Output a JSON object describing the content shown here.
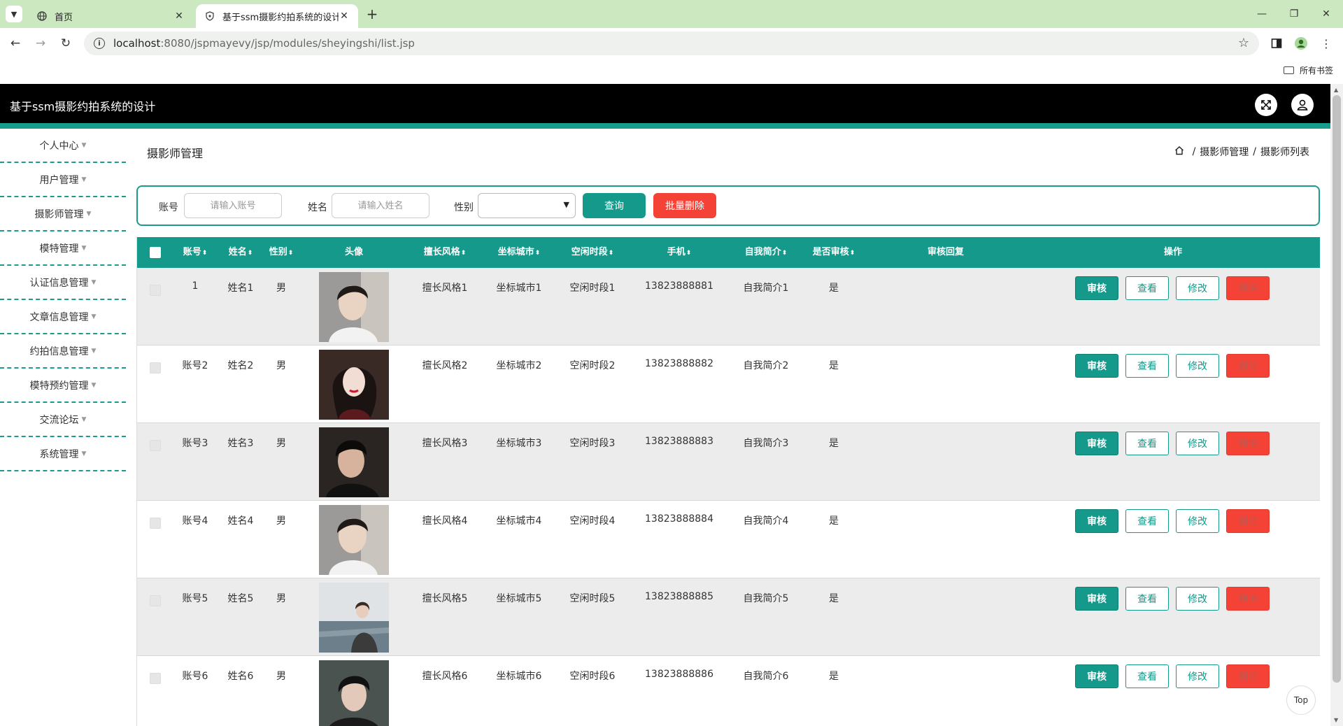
{
  "browser": {
    "tabs": [
      {
        "label": "首页",
        "active": false
      },
      {
        "label": "基于ssm摄影约拍系统的设计",
        "active": true
      }
    ],
    "url_host": "localhost",
    "url_rest": ":8080/jspmayevy/jsp/modules/sheyingshi/list.jsp",
    "bookmarks_label": "所有书签"
  },
  "header": {
    "title": "基于ssm摄影约拍系统的设计"
  },
  "sidebar": {
    "items": [
      {
        "label": "个人中心"
      },
      {
        "label": "用户管理"
      },
      {
        "label": "摄影师管理"
      },
      {
        "label": "模特管理"
      },
      {
        "label": "认证信息管理"
      },
      {
        "label": "文章信息管理"
      },
      {
        "label": "约拍信息管理"
      },
      {
        "label": "模特预约管理"
      },
      {
        "label": "交流论坛"
      },
      {
        "label": "系统管理"
      }
    ]
  },
  "page": {
    "title": "摄影师管理",
    "breadcrumb": [
      "摄影师管理",
      "摄影师列表"
    ]
  },
  "search": {
    "account_label": "账号",
    "account_placeholder": "请输入账号",
    "name_label": "姓名",
    "name_placeholder": "请输入姓名",
    "gender_label": "性别",
    "gender_value": "",
    "query_button": "查询",
    "batch_delete_button": "批量删除"
  },
  "table": {
    "columns": {
      "account": "账号",
      "name": "姓名",
      "gender": "性别",
      "avatar": "头像",
      "style": "擅长风格",
      "city": "坐标城市",
      "free_time": "空闲时段",
      "phone": "手机",
      "intro": "自我简介",
      "approved": "是否审核",
      "reply": "审核回复",
      "actions": "操作"
    },
    "rows": [
      {
        "account": "1",
        "name": "姓名1",
        "gender": "男",
        "style": "擅长风格1",
        "city": "坐标城市1",
        "free_time": "空闲时段1",
        "phone": "13823888881",
        "intro": "自我简介1",
        "approved": "是",
        "reply": ""
      },
      {
        "account": "账号2",
        "name": "姓名2",
        "gender": "男",
        "style": "擅长风格2",
        "city": "坐标城市2",
        "free_time": "空闲时段2",
        "phone": "13823888882",
        "intro": "自我简介2",
        "approved": "是",
        "reply": ""
      },
      {
        "account": "账号3",
        "name": "姓名3",
        "gender": "男",
        "style": "擅长风格3",
        "city": "坐标城市3",
        "free_time": "空闲时段3",
        "phone": "13823888883",
        "intro": "自我简介3",
        "approved": "是",
        "reply": ""
      },
      {
        "account": "账号4",
        "name": "姓名4",
        "gender": "男",
        "style": "擅长风格4",
        "city": "坐标城市4",
        "free_time": "空闲时段4",
        "phone": "13823888884",
        "intro": "自我简介4",
        "approved": "是",
        "reply": ""
      },
      {
        "account": "账号5",
        "name": "姓名5",
        "gender": "男",
        "style": "擅长风格5",
        "city": "坐标城市5",
        "free_time": "空闲时段5",
        "phone": "13823888885",
        "intro": "自我简介5",
        "approved": "是",
        "reply": ""
      },
      {
        "account": "账号6",
        "name": "姓名6",
        "gender": "男",
        "style": "擅长风格6",
        "city": "坐标城市6",
        "free_time": "空闲时段6",
        "phone": "13823888886",
        "intro": "自我简介6",
        "approved": "是",
        "reply": ""
      }
    ],
    "actions": {
      "audit": "审核",
      "view": "查看",
      "edit": "修改",
      "delete": "删除"
    }
  },
  "back_to_top": "Top",
  "colors": {
    "accent": "#14998a",
    "danger": "#f44336",
    "header_bg": "#000000",
    "tabbar_bg": "#cce8c0"
  },
  "icons": [
    "chevron-down-icon",
    "globe-icon",
    "shield-icon",
    "close-icon",
    "plus-icon",
    "minimize-icon",
    "restore-icon",
    "back-icon",
    "forward-icon",
    "reload-icon",
    "info-icon",
    "star-icon",
    "sidepanel-icon",
    "profile-icon",
    "kebab-icon",
    "folder-icon",
    "fullscreen-icon",
    "user-icon",
    "home-icon"
  ]
}
